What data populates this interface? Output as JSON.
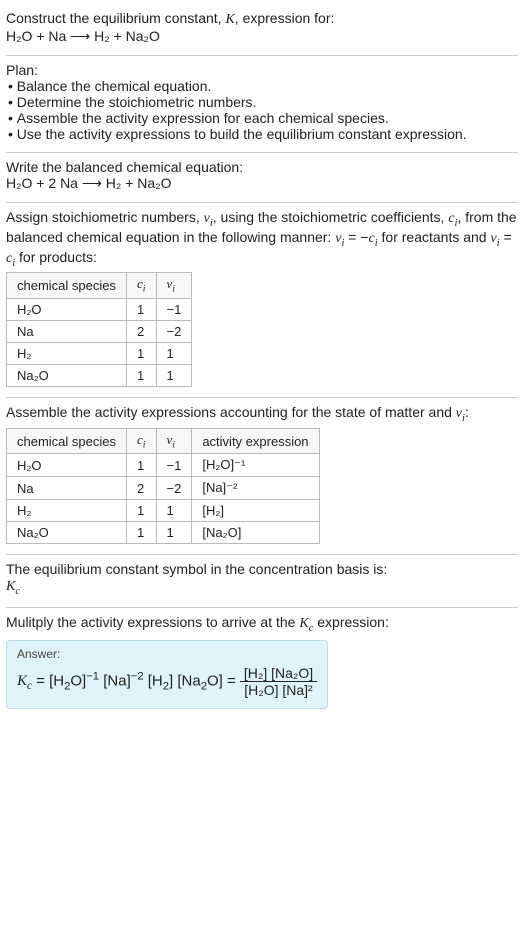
{
  "header": {
    "line1": "Construct the equilibrium constant, K, expression for:",
    "equation": "H₂O + Na ⟶ H₂ + Na₂O"
  },
  "plan": {
    "title": "Plan:",
    "items": [
      "Balance the chemical equation.",
      "Determine the stoichiometric numbers.",
      "Assemble the activity expression for each chemical species.",
      "Use the activity expressions to build the equilibrium constant expression."
    ]
  },
  "balanced": {
    "title": "Write the balanced chemical equation:",
    "equation": "H₂O + 2 Na ⟶ H₂ + Na₂O"
  },
  "stoich": {
    "intro1": "Assign stoichiometric numbers, νᵢ, using the stoichiometric coefficients, cᵢ, from the balanced chemical equation in the following manner: νᵢ = −cᵢ for reactants and νᵢ = cᵢ for products:",
    "headers": [
      "chemical species",
      "cᵢ",
      "νᵢ"
    ],
    "rows": [
      [
        "H₂O",
        "1",
        "−1"
      ],
      [
        "Na",
        "2",
        "−2"
      ],
      [
        "H₂",
        "1",
        "1"
      ],
      [
        "Na₂O",
        "1",
        "1"
      ]
    ]
  },
  "activity": {
    "intro": "Assemble the activity expressions accounting for the state of matter and νᵢ:",
    "headers": [
      "chemical species",
      "cᵢ",
      "νᵢ",
      "activity expression"
    ],
    "rows": [
      [
        "H₂O",
        "1",
        "−1",
        "[H₂O]⁻¹"
      ],
      [
        "Na",
        "2",
        "−2",
        "[Na]⁻²"
      ],
      [
        "H₂",
        "1",
        "1",
        "[H₂]"
      ],
      [
        "Na₂O",
        "1",
        "1",
        "[Na₂O]"
      ]
    ]
  },
  "symbol": {
    "line1": "The equilibrium constant symbol in the concentration basis is:",
    "symbol": "Kᴄ"
  },
  "final": {
    "intro": "Mulitply the activity expressions to arrive at the Kᴄ expression:",
    "answer_label": "Answer:",
    "lhs": "Kᴄ = [H₂O]⁻¹ [Na]⁻² [H₂] [Na₂O] = ",
    "frac_num": "[H₂] [Na₂O]",
    "frac_den": "[H₂O] [Na]²"
  },
  "chart_data": {
    "type": "table",
    "tables": [
      {
        "title": "Stoichiometric numbers",
        "columns": [
          "chemical species",
          "c_i",
          "nu_i"
        ],
        "rows": [
          [
            "H2O",
            1,
            -1
          ],
          [
            "Na",
            2,
            -2
          ],
          [
            "H2",
            1,
            1
          ],
          [
            "Na2O",
            1,
            1
          ]
        ]
      },
      {
        "title": "Activity expressions",
        "columns": [
          "chemical species",
          "c_i",
          "nu_i",
          "activity expression"
        ],
        "rows": [
          [
            "H2O",
            1,
            -1,
            "[H2O]^-1"
          ],
          [
            "Na",
            2,
            -2,
            "[Na]^-2"
          ],
          [
            "H2",
            1,
            1,
            "[H2]"
          ],
          [
            "Na2O",
            1,
            1,
            "[Na2O]"
          ]
        ]
      }
    ]
  }
}
